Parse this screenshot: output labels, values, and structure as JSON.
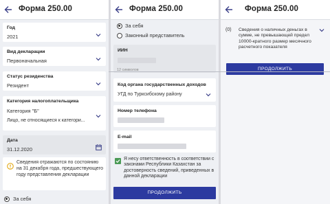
{
  "screen1": {
    "title": "Форма 250.00",
    "year_label": "Год",
    "year_value": "2021",
    "decl_label": "Вид декларации",
    "decl_value": "Первоначальная",
    "residency_label": "Статус резиденства",
    "residency_value": "Резидент",
    "category_label": "Категория налогоплательщика",
    "category_line1": "Категория \"Б\"",
    "category_line2": "Лицо, не относящиеся к категори...",
    "date_label": "Дата",
    "date_value": "31.12.2020",
    "info_note": "Сведения отражаются по состоянию на 31 декабря года, предшествующего году представления декларации",
    "radio_self": "За себя"
  },
  "screen2": {
    "title": "Форма 250.00",
    "radio_self": "За себя",
    "radio_rep": "Законный представитель",
    "iin_label": "ИИН",
    "iin_hint": "12 символов",
    "org_label": "Код органа государственных доходов",
    "org_value": "УГД по Турксибскому району",
    "phone_label": "Номер телефона",
    "email_label": "E-mail",
    "consent_text": "Я несу ответственность в соответствии с законами Республики Казахстан за достоверность сведений, приведенных в данной декларации",
    "continue_label": "ПРОДОЛЖИТЬ"
  },
  "screen3": {
    "title": "Форма 250.00",
    "item_code": "(0)",
    "item_text": "Сведения о наличных деньгах в сумме, не превышающей предел 10000-кратного размер месячного расчетного показателя",
    "continue_label": "ПРОДОЛЖИТЬ"
  },
  "colors": {
    "accent": "#2c3aa0",
    "check": "#4a9a55",
    "background": "#eef0f4"
  }
}
